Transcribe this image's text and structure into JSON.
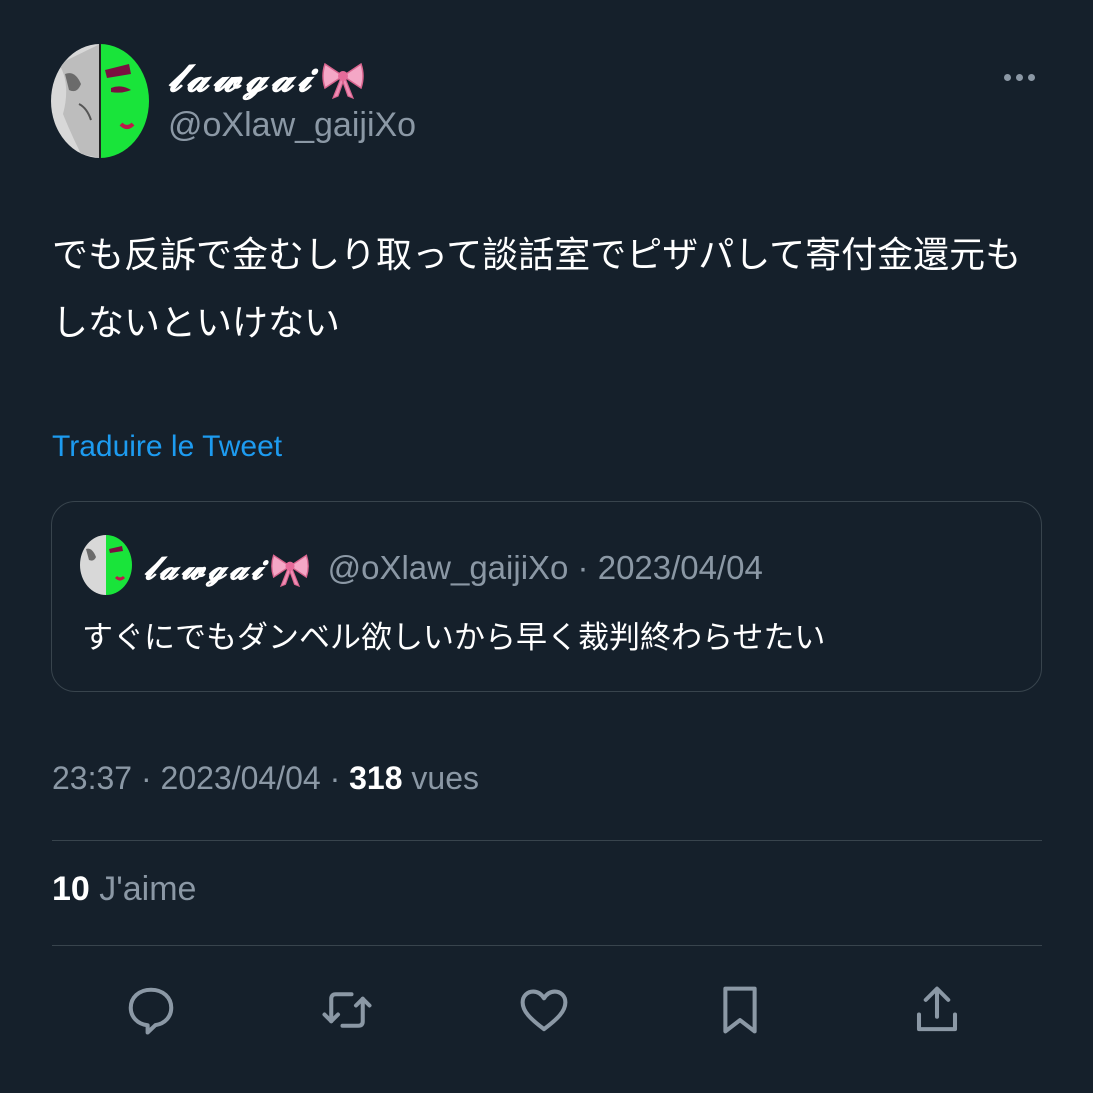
{
  "author": {
    "display_name": "𝓵𝓪𝔀𝓰𝓪𝓲",
    "handle": "@oXlaw_gaijiXo",
    "avatar_icon": "profile-avatar",
    "bow_emoji": "ribbon"
  },
  "tweet": {
    "text": "でも反訴で金むしり取って談話室でピザパして寄付金還元もしないといけない",
    "translate_link": "Traduire le Tweet"
  },
  "quoted_tweet": {
    "display_name": "𝓵𝓪𝔀𝓰𝓪𝓲",
    "handle_date": "@oXlaw_gaijiXo · 2023/04/04",
    "text": "すぐにでもダンベル欲しいから早く裁判終わらせたい"
  },
  "meta": {
    "time": "23:37",
    "date": "2023/04/04",
    "separator": "·",
    "views_count": "318",
    "views_label": "vues"
  },
  "likes": {
    "count": "10",
    "label": "J'aime"
  },
  "actions": [
    {
      "name": "reply",
      "icon": "reply-icon"
    },
    {
      "name": "retweet",
      "icon": "retweet-icon"
    },
    {
      "name": "like",
      "icon": "heart-icon"
    },
    {
      "name": "bookmark",
      "icon": "bookmark-icon"
    },
    {
      "name": "share",
      "icon": "share-icon"
    }
  ],
  "colors": {
    "background": "#15202b",
    "accent": "#1d9bf0",
    "secondary_text": "#8b98a5",
    "border": "#38444d"
  }
}
